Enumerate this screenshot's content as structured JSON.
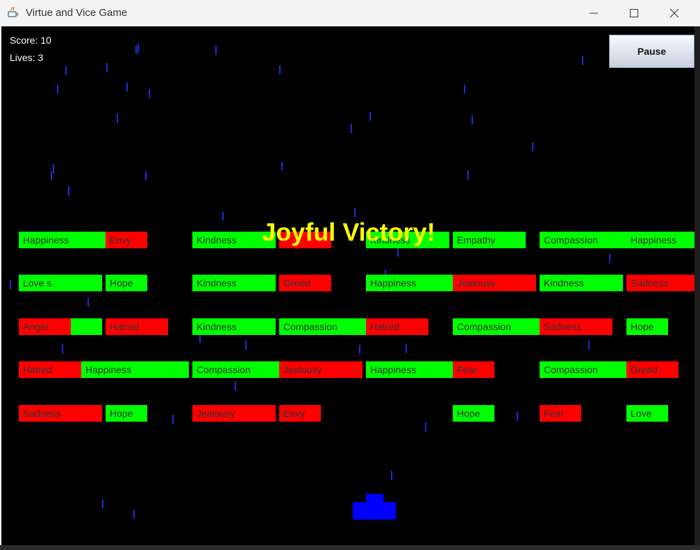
{
  "window": {
    "title": "Virtue and Vice Game",
    "icon": "java-icon",
    "controls": [
      "minimize",
      "maximize",
      "close"
    ]
  },
  "hud": {
    "score_label": "Score: 10",
    "lives_label": "Lives: 3"
  },
  "pause_button": {
    "label": "Pause"
  },
  "message": "Joyful Victory!",
  "colors": {
    "background": "#000000",
    "virtue": "#00ff00",
    "vice": "#ff0000",
    "player": "#0000ff",
    "rain": "#1f2bd9",
    "message": "#ffff00"
  },
  "rows": [
    [
      {
        "text": "Happiness",
        "kind": "virtue"
      },
      {
        "text": "Envy",
        "kind": "vice"
      },
      {
        "text": "Kindness",
        "kind": "virtue"
      },
      {
        "text": "",
        "kind": "vice"
      },
      {
        "text": "Kindness",
        "kind": "virtue"
      },
      {
        "text": "Empathy",
        "kind": "virtue"
      },
      {
        "text": "Compassion",
        "kind": "virtue"
      },
      {
        "text": "Happiness",
        "kind": "virtue"
      }
    ],
    [
      {
        "text": "Love     s",
        "kind": "virtue"
      },
      {
        "text": "Hope",
        "kind": "virtue"
      },
      {
        "text": "Kindness",
        "kind": "virtue"
      },
      {
        "text": "Greed",
        "kind": "vice"
      },
      {
        "text": "Happiness",
        "kind": "virtue"
      },
      {
        "text": "Jealousy",
        "kind": "vice"
      },
      {
        "text": "Kindness",
        "kind": "virtue"
      },
      {
        "text": "Sadness",
        "kind": "vice"
      }
    ],
    [
      {
        "text": "Anger",
        "kind": "vice"
      },
      {
        "text": "",
        "kind": "virtue"
      },
      {
        "text": "Hatred",
        "kind": "vice"
      },
      {
        "text": "Kindness",
        "kind": "virtue"
      },
      {
        "text": "Compassion",
        "kind": "virtue"
      },
      {
        "text": "Hatred",
        "kind": "vice"
      },
      {
        "text": "Compassion",
        "kind": "virtue"
      },
      {
        "text": "Sadness",
        "kind": "vice"
      },
      {
        "text": "Hope",
        "kind": "virtue"
      }
    ],
    [
      {
        "text": "Hatred",
        "kind": "vice"
      },
      {
        "text": "Happiness",
        "kind": "virtue"
      },
      {
        "text": "Compassion",
        "kind": "virtue"
      },
      {
        "text": "Jealousy",
        "kind": "vice"
      },
      {
        "text": "Happiness",
        "kind": "virtue"
      },
      {
        "text": "Fear",
        "kind": "vice"
      },
      {
        "text": "Compassion",
        "kind": "virtue"
      },
      {
        "text": "Greed",
        "kind": "vice"
      }
    ],
    [
      {
        "text": "Sadness",
        "kind": "vice"
      },
      {
        "text": "Hope",
        "kind": "virtue"
      },
      {
        "text": "Jealousy",
        "kind": "vice"
      },
      {
        "text": "Envy",
        "kind": "vice"
      },
      {
        "text": "Hope",
        "kind": "virtue"
      },
      {
        "text": "Fear",
        "kind": "vice"
      },
      {
        "text": "Love",
        "kind": "virtue"
      }
    ]
  ]
}
